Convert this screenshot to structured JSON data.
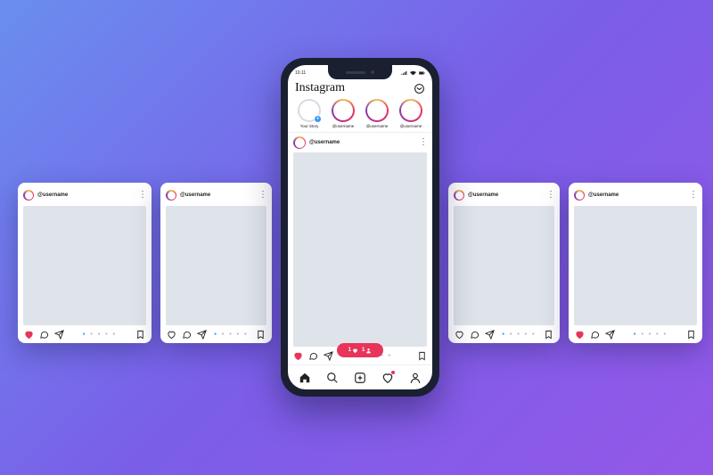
{
  "app": {
    "name": "Instagram"
  },
  "status_bar": {
    "time": "10.11"
  },
  "stories": {
    "your_story": "Your Story",
    "items": [
      "@username",
      "@username",
      "@username"
    ]
  },
  "post": {
    "username": "@username",
    "like_notification_count": "1",
    "follow_notification_count": "1"
  },
  "side_cards": [
    {
      "username": "@username"
    },
    {
      "username": "@username"
    },
    {
      "username": "@username"
    },
    {
      "username": "@username"
    }
  ],
  "colors": {
    "heart": "#e8345a",
    "accent_blue": "#3897f0",
    "placeholder": "#dfe3ea"
  }
}
